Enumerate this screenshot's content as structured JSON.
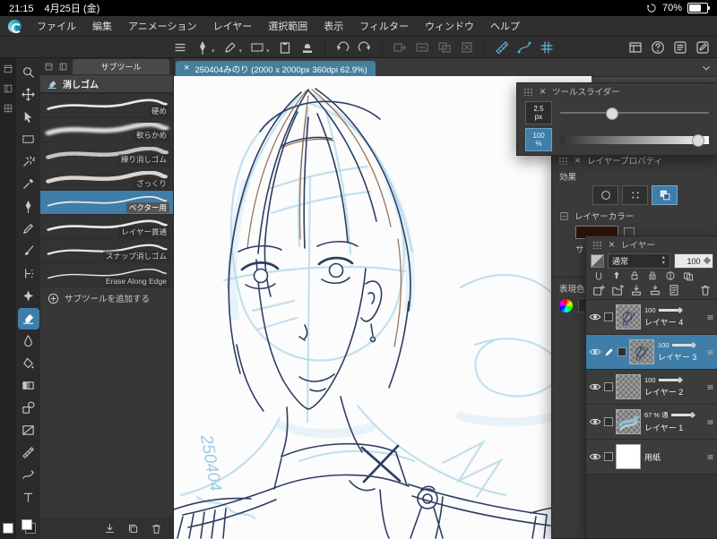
{
  "colors": {
    "accent_blue": "#3e7ea9",
    "canvas_bg": "#474747",
    "tab_teal": "#44809c"
  },
  "status_bar": {
    "time": "21:15",
    "date": "4月25日 (金)",
    "battery_percent": "70%",
    "battery_level": 70
  },
  "menu_bar": {
    "items": [
      "ファイル",
      "編集",
      "アニメーション",
      "レイヤー",
      "選択範囲",
      "表示",
      "フィルター",
      "ウィンドウ",
      "ヘルプ"
    ]
  },
  "top_toolbar": {
    "left_icons": [
      "hamburger",
      "pen",
      "marker",
      "marquee",
      "clipboard",
      "stamp"
    ],
    "history_icons": [
      "undo",
      "redo"
    ],
    "disabled_icons": [
      "sel-a",
      "sel-b",
      "sel-c",
      "sel-d"
    ],
    "active_icons": [
      "snap-ruler",
      "snap-curve",
      "snap-grid"
    ],
    "right_icons": [
      "console",
      "help",
      "memo",
      "editbox"
    ]
  },
  "palette_dock": {
    "top_icons": [
      "dock-a",
      "dock-b",
      "dock-c"
    ]
  },
  "tool_column": {
    "tools": [
      {
        "id": "zoom"
      },
      {
        "id": "move"
      },
      {
        "id": "operate"
      },
      {
        "id": "select"
      },
      {
        "id": "autoselect"
      },
      {
        "id": "eyedropper"
      },
      {
        "id": "pen"
      },
      {
        "id": "pencil"
      },
      {
        "id": "brush"
      },
      {
        "id": "airbrush"
      },
      {
        "id": "decoration"
      },
      {
        "id": "eraser",
        "active": true
      },
      {
        "id": "blend"
      },
      {
        "id": "fill"
      },
      {
        "id": "gradient"
      },
      {
        "id": "figure"
      },
      {
        "id": "frame"
      },
      {
        "id": "ruler"
      },
      {
        "id": "correct"
      },
      {
        "id": "text"
      }
    ]
  },
  "subtool_panel": {
    "tab_label": "サブツール",
    "group_title": "消しゴム",
    "items": [
      {
        "label": "硬め",
        "stroke": "hard"
      },
      {
        "label": "軟らかめ",
        "stroke": "soft"
      },
      {
        "label": "練り消しゴム",
        "stroke": "knead"
      },
      {
        "label": "ざっくり",
        "stroke": "rough"
      },
      {
        "label": "ベクター用",
        "stroke": "vector",
        "selected": true
      },
      {
        "label": "レイヤー貫通",
        "stroke": "layer"
      },
      {
        "label": "スナップ消しゴム",
        "stroke": "snap"
      },
      {
        "label": "Erase Along Edge",
        "stroke": "edge"
      }
    ],
    "add_label": "サブツールを追加する"
  },
  "canvas": {
    "tab_title": "250404みのり (2000 x 2000px 360dpi 62.9%)",
    "signature": "250404"
  },
  "tool_slider_panel": {
    "title": "ツールスライダー",
    "rows": [
      {
        "value": "2.5",
        "unit": "px",
        "percent": 35,
        "active": false,
        "checkered": false
      },
      {
        "value": "100",
        "unit": "%",
        "percent": 93,
        "active": true,
        "checkered": true
      }
    ]
  },
  "layer_property_panel": {
    "title": "レイヤープロパティ",
    "effect_label": "効果",
    "layer_color_label": "レイヤーカラー",
    "layer_color": "#2a130a",
    "sub_color_label": "サブカラー",
    "sub_color": "#ffffff",
    "expression_label": "表現色"
  },
  "layer_panel": {
    "title": "レイヤー",
    "blend_mode": "通常",
    "opacity_value": "100",
    "layers": [
      {
        "name": "レイヤー 4",
        "opacity": "100",
        "thumb": "sketch"
      },
      {
        "name": "レイヤー 3",
        "opacity": "100",
        "thumb": "sketch",
        "selected": true,
        "editing": true
      },
      {
        "name": "レイヤー 2",
        "opacity": "100",
        "thumb": "empty"
      },
      {
        "name": "レイヤー 1",
        "opacity": "67 % 通",
        "thumb": "blue"
      },
      {
        "name": "用紙",
        "opacity": "",
        "thumb": "paper"
      }
    ]
  }
}
